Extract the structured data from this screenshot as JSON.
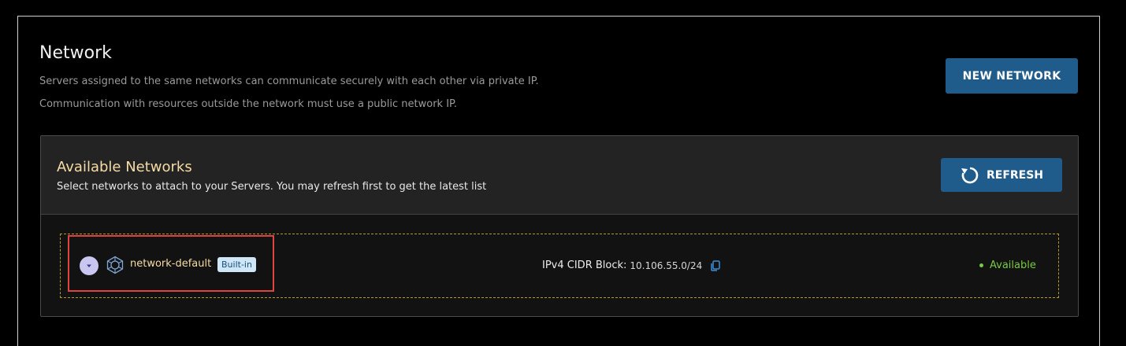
{
  "header": {
    "title": "Network",
    "description_line1": "Servers assigned to the same networks can communicate securely with each other via private IP.",
    "description_line2": "Communication with resources outside the network must use a public network IP.",
    "new_network_label": "NEW NETWORK"
  },
  "available_networks": {
    "title": "Available Networks",
    "subtitle": "Select networks to attach to your Servers. You may refresh first to get the latest list",
    "refresh_label": "REFRESH",
    "refresh_icon": "refresh-icon",
    "rows": [
      {
        "name": "network-default",
        "badge": "Built-in",
        "cidr_label": "IPv4 CIDR Block:",
        "cidr_value": "10.106.55.0/24",
        "status": "Available",
        "icons": [
          "chevron-down-icon",
          "network-icon",
          "copy-icon"
        ]
      }
    ]
  },
  "colors": {
    "primary_button": "#1f5c8c",
    "accent_text": "#f6dca6",
    "status_green": "#7ac943",
    "highlight_red": "#e0443e",
    "row_border": "#b59a2a"
  }
}
